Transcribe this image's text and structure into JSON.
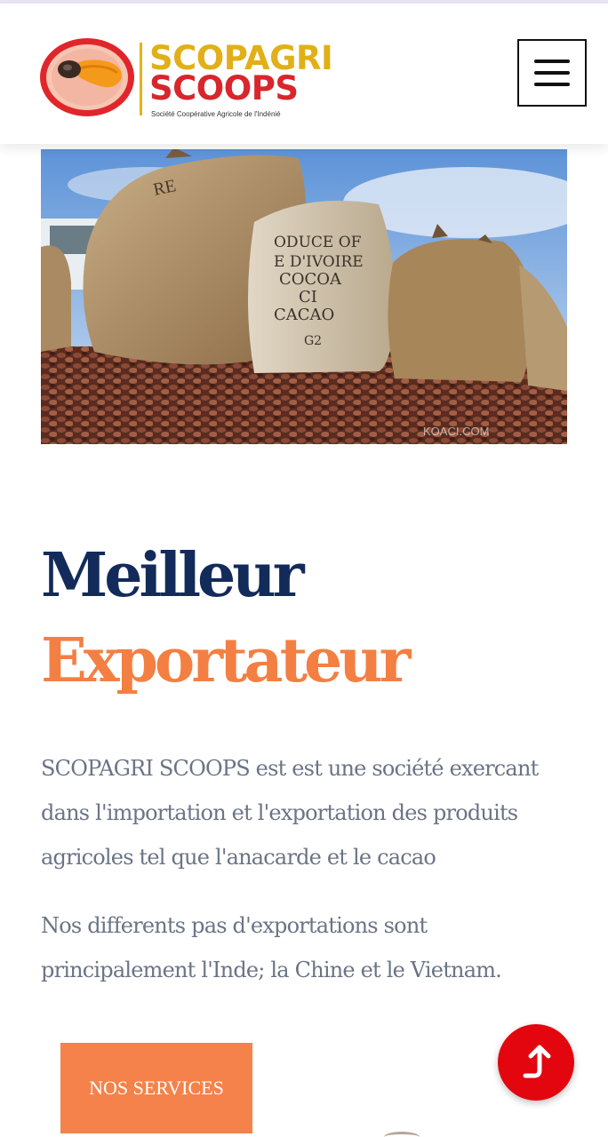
{
  "header": {
    "logo": {
      "word1": "SCOPAGRI",
      "word2": "SCOOPS",
      "tagline": "Société Coopérative Agricole de l'Indénié",
      "colors": {
        "gold": "#e1b019",
        "red": "#d8262c",
        "orange": "#f5a623"
      }
    },
    "menu_icon": "hamburger-icon"
  },
  "hero": {
    "bag_texts": [
      "RE",
      "ODUCE OF",
      "E D'IVOIRE",
      "COCOA",
      "CI",
      "CACAO",
      "G2"
    ],
    "watermark": "KOACI.COM"
  },
  "main": {
    "title_line1": "Meilleur",
    "title_line2": "Exportateur",
    "paragraph1": "SCOPAGRI SCOOPS est est une société exercant dans l'importation et l'exportation des produits agricoles tel que l'anacarde et le cacao",
    "paragraph2": "Nos differents pas d'exportations sont principalement l'Inde; la Chine et le Vietnam.",
    "services_button": "NOS SERVICES"
  },
  "colors": {
    "title_dark": "#122b5a",
    "title_accent": "#f47f42",
    "body_text": "#6b7486",
    "button": "#f4824a",
    "scroll_top": "#e3060f"
  }
}
